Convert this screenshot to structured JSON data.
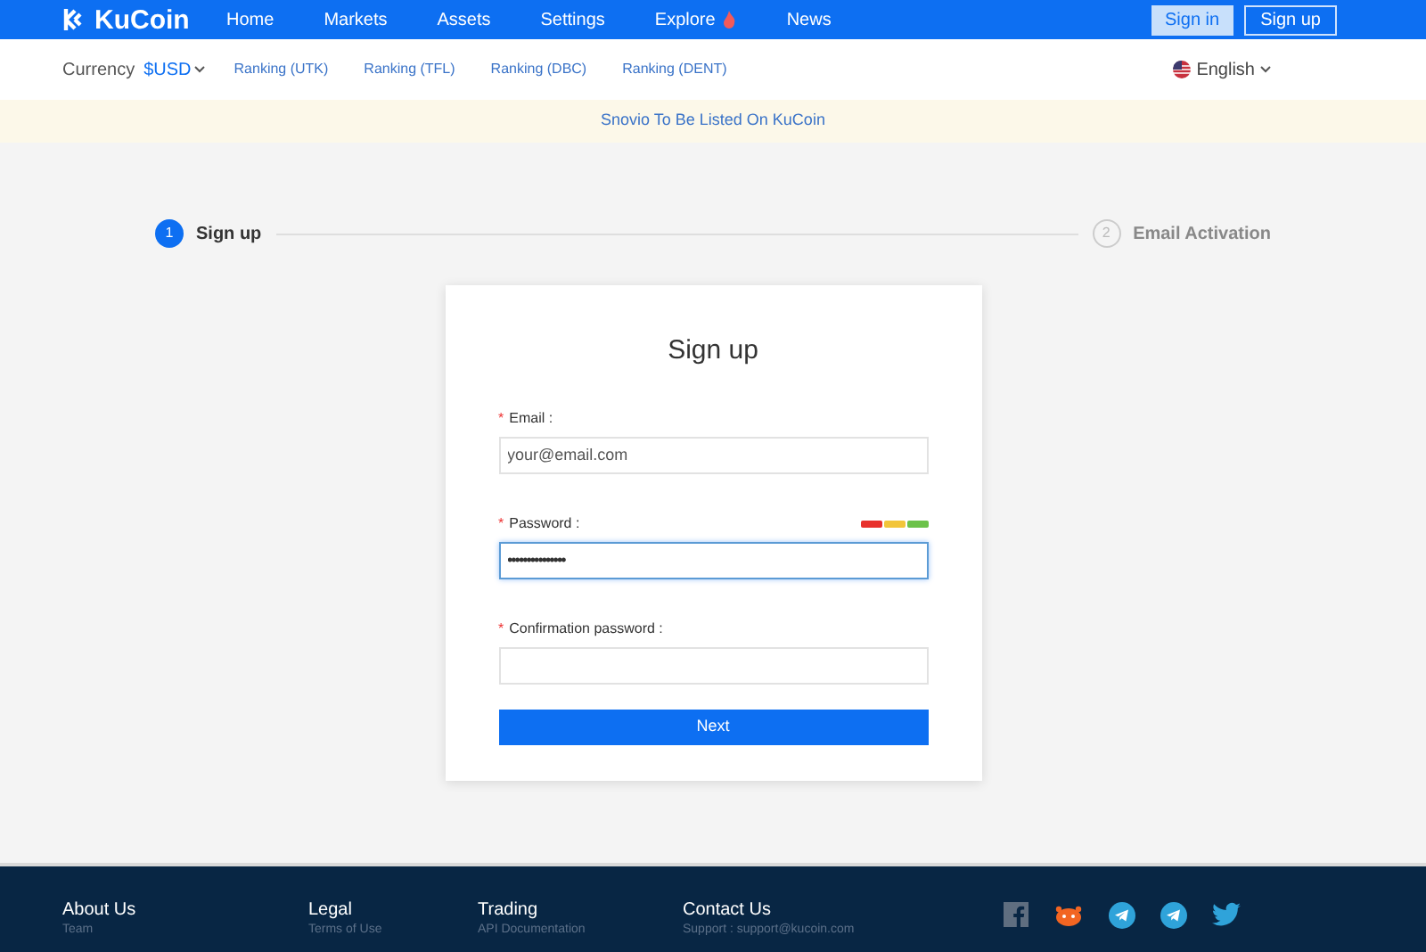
{
  "header": {
    "logo": "KuCoin",
    "nav": [
      {
        "label": "Home"
      },
      {
        "label": "Markets"
      },
      {
        "label": "Assets"
      },
      {
        "label": "Settings"
      },
      {
        "label": "Explore",
        "hot": true
      },
      {
        "label": "News"
      }
    ],
    "buttons": [
      {
        "label": "Sign in",
        "kind": "filled"
      },
      {
        "label": "Sign up",
        "kind": "outline"
      }
    ]
  },
  "subnav": {
    "currency_label": "Currency",
    "currency_value": "$USD",
    "rankings": [
      "Ranking (UTK)",
      "Ranking (TFL)",
      "Ranking (DBC)",
      "Ranking (DENT)"
    ],
    "language": "English"
  },
  "banner": "Snovio To Be Listed On KuCoin",
  "steps": [
    {
      "number": "1",
      "label": "Sign up",
      "selected": true
    },
    {
      "number": "2",
      "label": "Email Activation",
      "selected": false
    }
  ],
  "form": {
    "title": "Sign up",
    "fields": [
      {
        "mark": "*",
        "label": "Email :",
        "placeholder": "your@email.com",
        "focused": false
      },
      {
        "mark": "*",
        "label": "Password :",
        "value": "•••••••••••••••",
        "focused": true,
        "strength": [
          {
            "color": "#e8312c"
          },
          {
            "color": "#f2c53a"
          },
          {
            "color": "#6cc24a"
          }
        ]
      },
      {
        "mark": "*",
        "label": "Confirmation password :",
        "focused": false
      }
    ],
    "submit": "Next"
  },
  "footer": {
    "columns": [
      {
        "title": "About Us",
        "item": "Team"
      },
      {
        "title": "Legal",
        "item": "Terms of Use"
      },
      {
        "title": "Trading",
        "item": "API Documentation"
      },
      {
        "title": "Contact Us",
        "item": "Support : support@kucoin.com"
      }
    ]
  }
}
